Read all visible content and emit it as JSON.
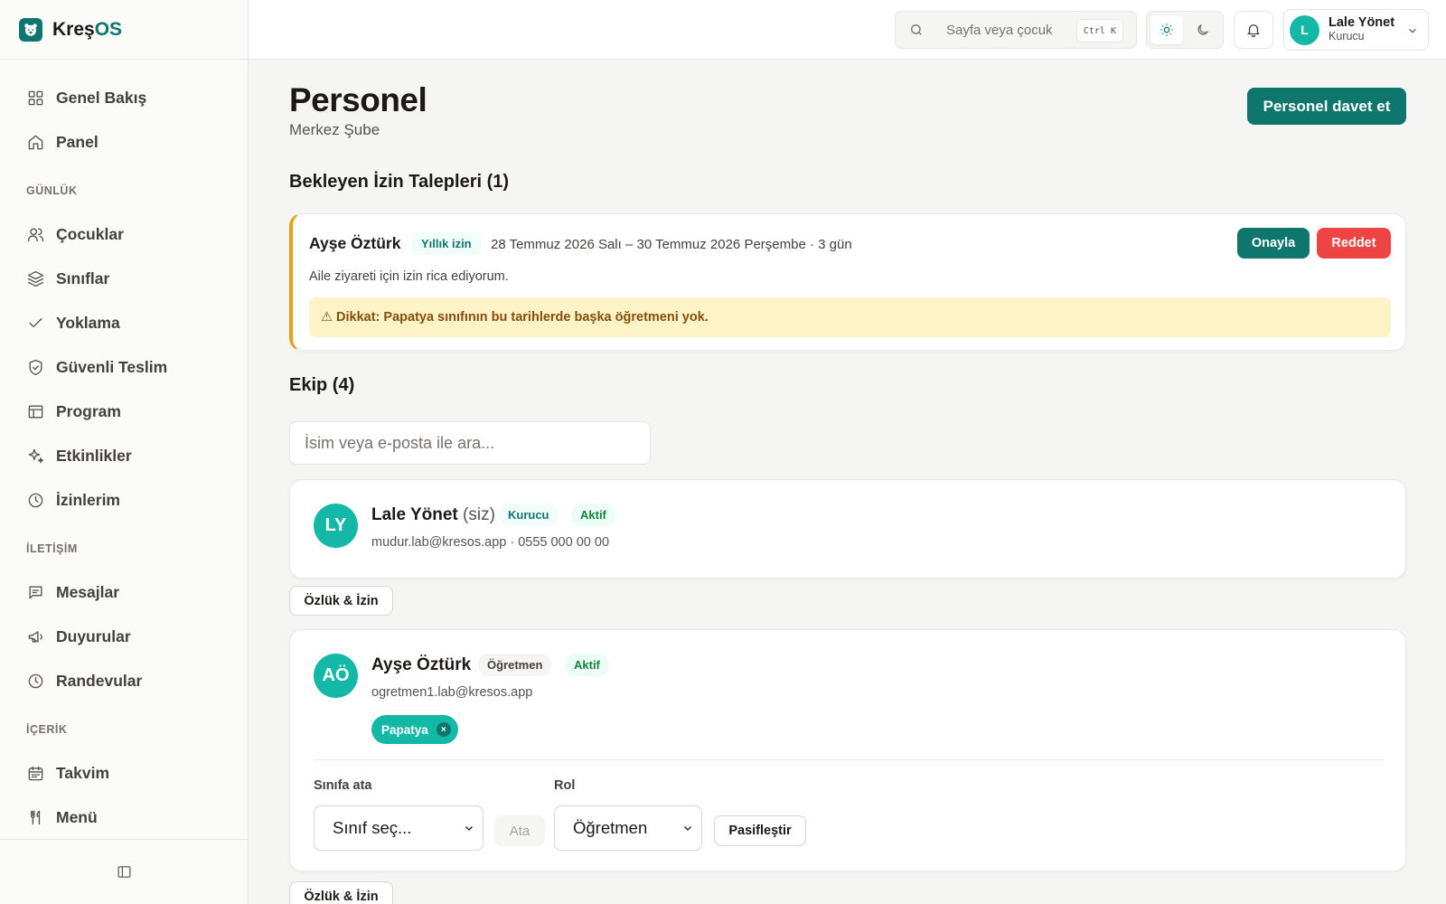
{
  "app": {
    "name_part1": "Kreş",
    "name_part2": "OS"
  },
  "sidebar": {
    "top_items": [
      {
        "label": "Genel Bakış",
        "icon": "grid-icon"
      },
      {
        "label": "Panel",
        "icon": "home-icon"
      }
    ],
    "sections": [
      {
        "title": "GÜNLÜK",
        "items": [
          {
            "label": "Çocuklar",
            "icon": "users-icon"
          },
          {
            "label": "Sınıflar",
            "icon": "layers-icon"
          },
          {
            "label": "Yoklama",
            "icon": "check-icon"
          },
          {
            "label": "Güvenli Teslim",
            "icon": "shield-check-icon"
          },
          {
            "label": "Program",
            "icon": "table-icon"
          },
          {
            "label": "Etkinlikler",
            "icon": "sparkles-icon"
          },
          {
            "label": "İzinlerim",
            "icon": "clock-icon"
          }
        ]
      },
      {
        "title": "İLETİŞİM",
        "items": [
          {
            "label": "Mesajlar",
            "icon": "message-icon"
          },
          {
            "label": "Duyurular",
            "icon": "megaphone-icon"
          },
          {
            "label": "Randevular",
            "icon": "clock-icon"
          }
        ]
      },
      {
        "title": "İÇERİK",
        "items": [
          {
            "label": "Takvim",
            "icon": "calendar-icon"
          },
          {
            "label": "Menü",
            "icon": "utensils-icon"
          }
        ]
      }
    ]
  },
  "topbar": {
    "search_placeholder": "Sayfa veya çocuk",
    "shortcut": "Ctrl K",
    "user": {
      "initial": "L",
      "name": "Lale Yönet",
      "role": "Kurucu"
    }
  },
  "page": {
    "title": "Personel",
    "subtitle": "Merkez Şube",
    "invite_button": "Personel davet et"
  },
  "pending": {
    "title": "Bekleyen İzin Talepleri (1)",
    "request": {
      "name": "Ayşe Öztürk",
      "type": "Yıllık izin",
      "dates": "28 Temmuz 2026 Salı – 30 Temmuz 2026 Perşembe · 3 gün",
      "note": "Aile ziyareti için izin rica ediyorum.",
      "approve": "Onayla",
      "reject": "Reddet",
      "warning": "⚠ Dikkat: Papatya sınıfının bu tarihlerde başka öğretmeni yok."
    }
  },
  "team": {
    "title": "Ekip (4)",
    "search_placeholder": "İsim veya e-posta ile ara...",
    "members": [
      {
        "initials": "LY",
        "name": "Lale Yönet",
        "you": "(siz)",
        "role": "Kurucu",
        "status": "Aktif",
        "contact": "mudur.lab@kresos.app · 0555 000 00 00",
        "action": "Özlük & İzin"
      },
      {
        "initials": "AÖ",
        "name": "Ayşe Öztürk",
        "role": "Öğretmen",
        "status": "Aktif",
        "contact": "ogretmen1.lab@kresos.app",
        "class_chip": "Papatya",
        "assign_label": "Sınıfa ata",
        "assign_placeholder": "Sınıf seç...",
        "assign_button": "Ata",
        "role_label": "Rol",
        "role_value": "Öğretmen",
        "deactivate": "Pasifleştir",
        "action": "Özlük & İzin"
      }
    ]
  }
}
